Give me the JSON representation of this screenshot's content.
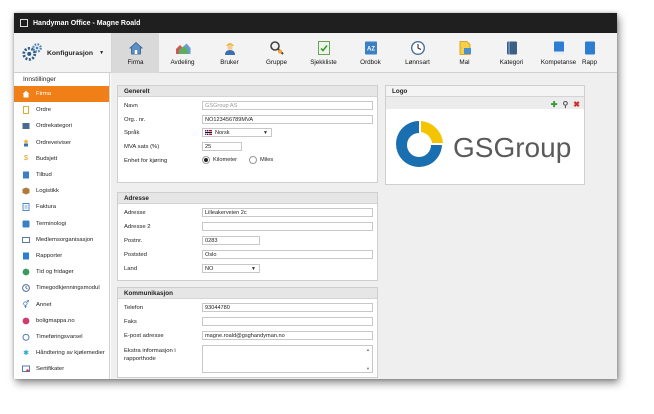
{
  "window": {
    "title": "Handyman Office - Magne Roald"
  },
  "toolbar": {
    "config_label": "Konfigurasjon",
    "items": [
      {
        "label": "Firma",
        "icon": "house-icon",
        "active": true
      },
      {
        "label": "Avdeling",
        "icon": "houses-icon"
      },
      {
        "label": "Bruker",
        "icon": "worker-icon"
      },
      {
        "label": "Gruppe",
        "icon": "magnifier-group-icon"
      },
      {
        "label": "Sjekkliste",
        "icon": "checklist-icon"
      },
      {
        "label": "Ordbok",
        "icon": "dictionary-icon"
      },
      {
        "label": "Lønnsart",
        "icon": "clock-icon"
      },
      {
        "label": "Mal",
        "icon": "template-icon"
      },
      {
        "label": "Kategori",
        "icon": "book-icon"
      },
      {
        "label": "Kompetanse",
        "icon": "blue-book-icon"
      },
      {
        "label": "Rapp",
        "icon": "report-icon"
      }
    ]
  },
  "sidebar": {
    "heading": "Innstillinger",
    "items": [
      {
        "label": "Firma",
        "icon": "house-icon",
        "active": true
      },
      {
        "label": "Ordre",
        "icon": "order-icon"
      },
      {
        "label": "Ordrekategori",
        "icon": "category-icon"
      },
      {
        "label": "Ordreveiviser",
        "icon": "wizard-icon"
      },
      {
        "label": "Budsjett",
        "icon": "budget-icon"
      },
      {
        "label": "Tilbud",
        "icon": "offer-icon"
      },
      {
        "label": "Logistikk",
        "icon": "box-icon"
      },
      {
        "label": "Faktura",
        "icon": "invoice-icon"
      },
      {
        "label": "Terminologi",
        "icon": "terminology-icon"
      },
      {
        "label": "Medlemsorganisasjon",
        "icon": "membership-icon"
      },
      {
        "label": "Rapporter",
        "icon": "report-icon"
      },
      {
        "label": "Tid og fridager",
        "icon": "calendar-icon"
      },
      {
        "label": "Timegodkjenningsmodul",
        "icon": "approval-icon"
      },
      {
        "label": "Annet",
        "icon": "gender-icon"
      },
      {
        "label": "boligmappa.no",
        "icon": "boligmappa-icon"
      },
      {
        "label": "Timeføringsvarsel",
        "icon": "alarm-icon"
      },
      {
        "label": "Håndtering av kjølemedier",
        "icon": "snowflake-icon"
      },
      {
        "label": "Sertifikater",
        "icon": "certificate-icon"
      }
    ]
  },
  "generelt": {
    "title": "Generelt",
    "navn_label": "Navn",
    "navn_value": "GSGroup AS",
    "orgnr_label": "Org.. nr.",
    "orgnr_value": "NO123456789MVA",
    "sprak_label": "Språk",
    "sprak_value": "Norsk",
    "mva_label": "MVA sats (%)",
    "mva_value": "25",
    "enhet_label": "Enhet for kjøring",
    "enhet_opt1": "Kilometer",
    "enhet_opt2": "Miles"
  },
  "logo": {
    "title": "Logo",
    "company_text": "GSGroup"
  },
  "adresse": {
    "title": "Adresse",
    "adresse_label": "Adresse",
    "adresse_value": "Lilleakerveien 2c",
    "adresse2_label": "Adresse 2",
    "adresse2_value": "",
    "postnr_label": "Postnr.",
    "postnr_value": "0283",
    "poststed_label": "Poststed",
    "poststed_value": "Oslo",
    "land_label": "Land",
    "land_value": "NO"
  },
  "kommunikasjon": {
    "title": "Kommunikasjon",
    "telefon_label": "Telefon",
    "telefon_value": "93044780",
    "faks_label": "Faks",
    "faks_value": "",
    "epost_label": "E-post adresse",
    "epost_value": "magne.roald@gsghandyman.no",
    "ekstra_label_line1": "Ekstra informasjon i",
    "ekstra_label_line2": "rapporthode"
  },
  "colors": {
    "accent": "#f07f18",
    "logo_blue": "#1a6fb0",
    "logo_yellow": "#f5c400",
    "text_gray": "#5a5a5a"
  }
}
